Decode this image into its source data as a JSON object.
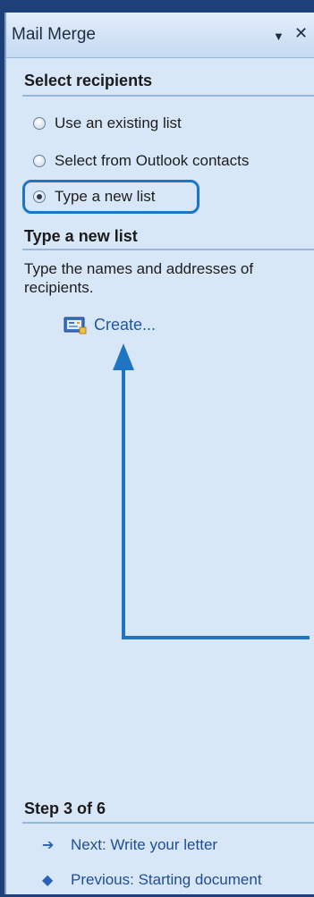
{
  "pane": {
    "title": "Mail Merge",
    "dropdown_icon": "▼",
    "close_icon": "✕"
  },
  "select_recipients": {
    "heading": "Select recipients",
    "options": [
      {
        "label": "Use an existing list",
        "checked": false
      },
      {
        "label": "Select from Outlook contacts",
        "checked": false
      },
      {
        "label": "Type a new list",
        "checked": true
      }
    ],
    "highlight_color": "#1f74c4"
  },
  "type_new_list": {
    "heading": "Type a new list",
    "description": "Type the names and addresses of recipients.",
    "create_label": "Create...",
    "create_icon": "address-book-icon"
  },
  "annotation": {
    "arrow_color": "#1f74c4",
    "arrow_icon": "arrow-up-icon"
  },
  "step": {
    "heading": "Step 3 of 6",
    "next_label": "Next: Write your letter",
    "next_icon": "arrow-right-icon",
    "previous_label": "Previous: Starting document",
    "previous_icon": "arrow-left-icon"
  }
}
